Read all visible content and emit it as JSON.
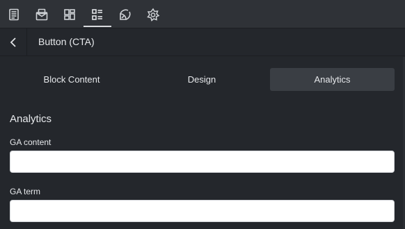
{
  "toolbar": {
    "tools": [
      {
        "icon": "page-icon"
      },
      {
        "icon": "mail-icon"
      },
      {
        "icon": "layout-icon"
      },
      {
        "icon": "list-icon",
        "active": true
      },
      {
        "icon": "palette-icon"
      },
      {
        "icon": "gear-icon"
      }
    ]
  },
  "header": {
    "back_icon": "chevron-left-icon",
    "title": "Button (CTA)"
  },
  "tabs": [
    {
      "label": "Block Content"
    },
    {
      "label": "Design"
    },
    {
      "label": "Analytics",
      "active": true
    }
  ],
  "section": {
    "title": "Analytics",
    "fields": [
      {
        "label": "GA content",
        "value": "",
        "placeholder": ""
      },
      {
        "label": "GA term",
        "value": "",
        "placeholder": ""
      }
    ]
  },
  "colors": {
    "background": "#24272c",
    "toolbar": "#2f3237",
    "active_tab": "#3a3e44",
    "text": "#e6e8eb"
  }
}
